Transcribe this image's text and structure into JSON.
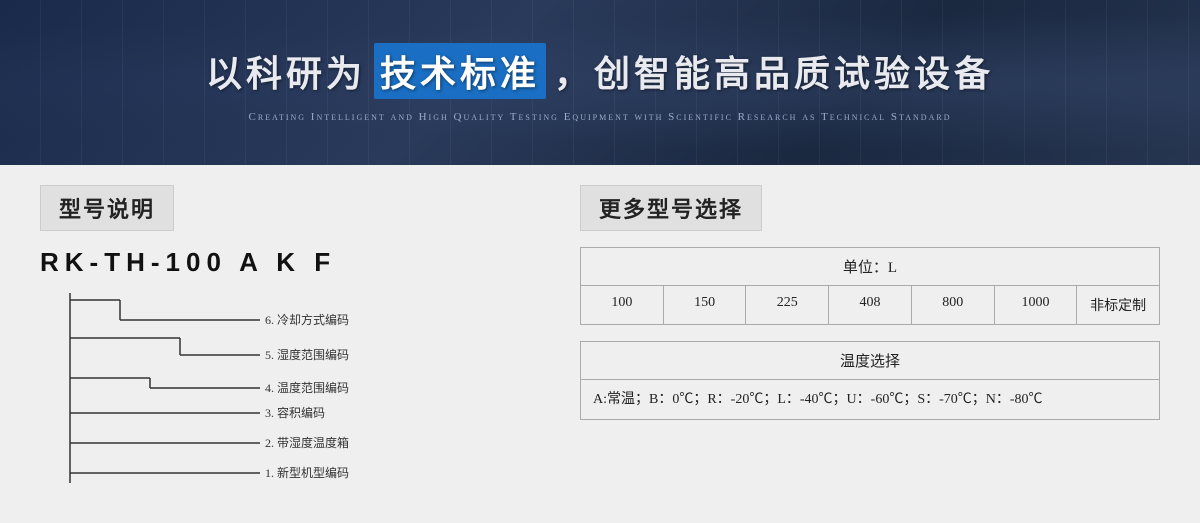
{
  "hero": {
    "title_prefix": "以科研为",
    "title_highlight": "技术标准",
    "title_suffix": "，创智能高品质试验设备",
    "subtitle": "Creating Intelligent and High Quality Testing Equipment with Scientific Research as Technical Standard"
  },
  "left": {
    "section_title": "型号说明",
    "model_code": "RK-TH-100  A  K  F",
    "diagram_labels": [
      "6. 冷却方式编码",
      "5. 湿度范围编码",
      "4. 温度范围编码",
      "3. 容积编码",
      "2. 带湿度温度箱",
      "1. 新型机型编码"
    ]
  },
  "right": {
    "section_title": "更多型号选择",
    "table_unit_label": "单位：L",
    "table_values": [
      "100",
      "150",
      "225",
      "408",
      "800",
      "1000",
      "非标定制"
    ],
    "temp_section_label": "温度选择",
    "temp_values": "A:常温；B：0℃；R：-20℃；L：-40℃；U：-60℃；S：-70℃；N：-80℃"
  }
}
